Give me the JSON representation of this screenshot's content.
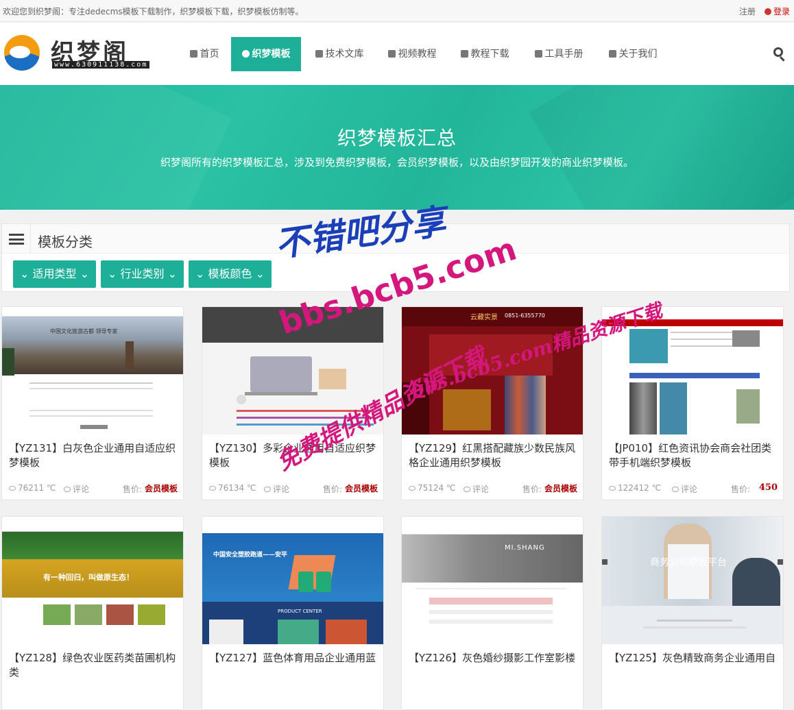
{
  "topbar": {
    "welcome": "欢迎您到织梦阁：专注dedecms模板下载制作，织梦模板下载，织梦模板仿制等。",
    "register": "注册",
    "login": "登录"
  },
  "logo": {
    "name": "织梦阁",
    "url": "www.630911138.com"
  },
  "nav": [
    {
      "label": "首页",
      "icon": "home-icon"
    },
    {
      "label": "织梦模板",
      "icon": "refresh-icon",
      "active": true
    },
    {
      "label": "技术文库",
      "icon": "document-icon"
    },
    {
      "label": "视频教程",
      "icon": "film-icon"
    },
    {
      "label": "教程下载",
      "icon": "cloud-download-icon"
    },
    {
      "label": "工具手册",
      "icon": "book-icon"
    },
    {
      "label": "关于我们",
      "icon": "smile-icon"
    }
  ],
  "banner": {
    "title": "织梦模板汇总",
    "subtitle": "织梦阁所有的织梦模板汇总，涉及到免费织梦模板，会员织梦模板，以及由织梦园开发的商业织梦模板。"
  },
  "filter": {
    "heading": "模板分类",
    "buttons": [
      "适用类型",
      "行业类别",
      "模板颜色"
    ]
  },
  "cards": [
    {
      "title": "【YZ131】白灰色企业通用自适应织梦模板",
      "views": "76211 ℃",
      "comments": "评论",
      "price_label": "售价:",
      "price": "会员模板"
    },
    {
      "title": "【YZ130】多彩企业通用自适应织梦模板",
      "views": "76134 ℃",
      "comments": "评论",
      "price_label": "售价:",
      "price": "会员模板"
    },
    {
      "title": "【YZ129】红黑搭配藏族少数民族风格企业通用织梦模板",
      "views": "75124 ℃",
      "comments": "评论",
      "price_label": "售价:",
      "price": "会员模板"
    },
    {
      "title": "【JP010】红色资讯协会商会社团类带手机端织梦模板",
      "views": "122412 ℃",
      "comments": "评论",
      "price_label": "售价:",
      "price": "450"
    },
    {
      "title": "【YZ128】绿色农业医药类苗圃机构类",
      "views": "",
      "comments": "",
      "price_label": "",
      "price": ""
    },
    {
      "title": "【YZ127】蓝色体育用品企业通用蓝",
      "views": "",
      "comments": "",
      "price_label": "",
      "price": ""
    },
    {
      "title": "【YZ126】灰色婚纱摄影工作室影楼",
      "views": "",
      "comments": "",
      "price_label": "",
      "price": ""
    },
    {
      "title": "【YZ125】灰色精致商务企业通用自",
      "views": "",
      "comments": "",
      "price_label": "",
      "price": ""
    }
  ],
  "thumb_text": {
    "card2_brand": "云藏实景",
    "card2_phone": "0851-6355770",
    "card7_headline": "商务公司模板平台",
    "card5_slogan": "中国安全塑胶跑道——安平",
    "card5_section": "PRODUCT CENTER",
    "card6_brand": "MI.SHANG",
    "card4_slogan": "有一种回归，叫做原生态！",
    "card0_slogan": "中国文化旅游古都 领导专家"
  },
  "watermark": {
    "line1": "不错吧分享",
    "line2": "bbs.bcb5.com",
    "line3": "bbs.bcb5.com精品资源下载",
    "line4": "免费提供精品资源下载"
  },
  "colors": {
    "accent": "#1eaf98",
    "price": "#aa0000",
    "watermark": "#d4177d"
  }
}
